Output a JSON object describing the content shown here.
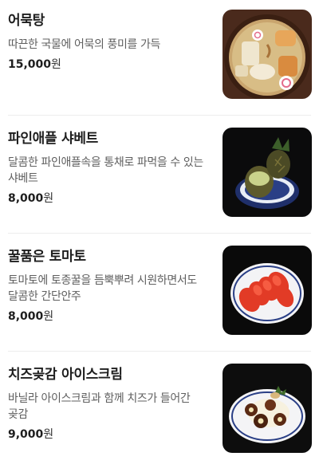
{
  "menu": {
    "items": [
      {
        "name": "어묵탕",
        "description": "따끈한 국물에 어묵의 풍미를 가득",
        "price": "15,000",
        "unit": "원"
      },
      {
        "name": "파인애플 샤베트",
        "description": "달콤한 파인애플속을 통채로 파먹을 수 있는 샤베트",
        "price": "8,000",
        "unit": "원"
      },
      {
        "name": "꿀품은 토마토",
        "description": "토마토에 토종꿀을 듬뿍뿌려 시원하면서도 달콤한 간단안주",
        "price": "8,000",
        "unit": "원"
      },
      {
        "name": "치즈곶감 아이스크림",
        "description": "바닐라 아이스크림과 함께 치즈가 들어간 곶감",
        "price": "9,000",
        "unit": "원"
      }
    ]
  }
}
